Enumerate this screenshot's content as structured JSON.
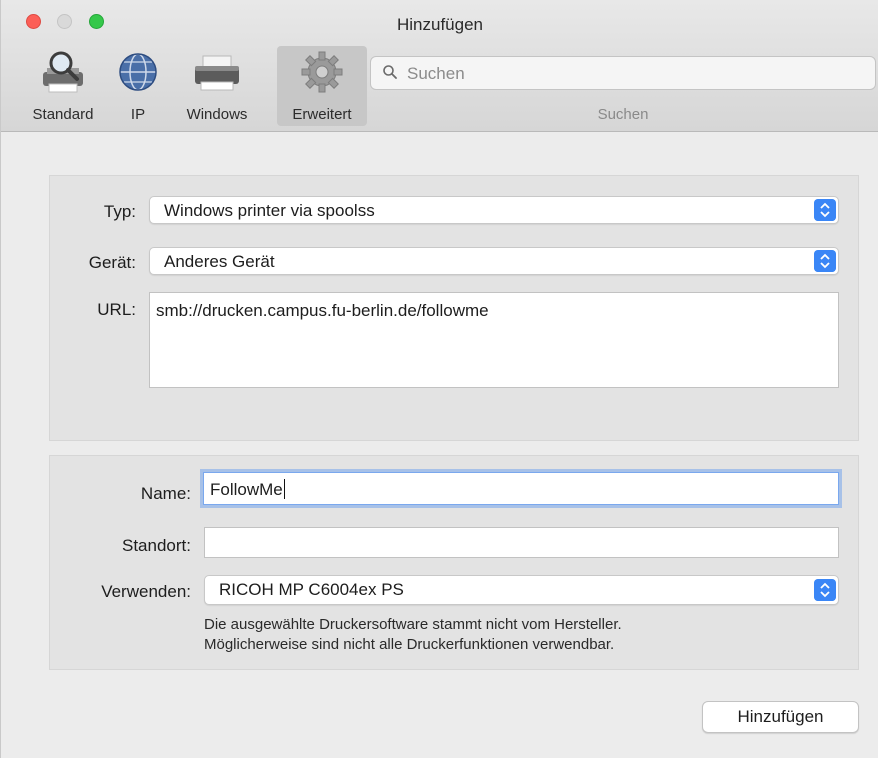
{
  "window": {
    "title": "Hinzufügen"
  },
  "toolbar": {
    "items": [
      {
        "label": "Standard",
        "icon": "magnifier-printer-icon"
      },
      {
        "label": "IP",
        "icon": "globe-icon"
      },
      {
        "label": "Windows",
        "icon": "printer-icon"
      },
      {
        "label": "Erweitert",
        "icon": "gear-icon",
        "selected": true
      }
    ],
    "search": {
      "placeholder": "Suchen",
      "caption": "Suchen"
    }
  },
  "connection": {
    "type_label": "Typ:",
    "type_value": "Windows printer via spoolss",
    "device_label": "Gerät:",
    "device_value": "Anderes Gerät",
    "url_label": "URL:",
    "url_value": "smb://drucken.campus.fu-berlin.de/followme"
  },
  "printer": {
    "name_label": "Name:",
    "name_value": "FollowMe",
    "location_label": "Standort:",
    "location_value": "",
    "use_label": "Verwenden:",
    "use_value": "RICOH MP C6004ex PS",
    "note_line1": "Die ausgewählte Druckersoftware stammt nicht vom Hersteller.",
    "note_line2": "Möglicherweise sind nicht alle Druckerfunktionen verwendbar."
  },
  "actions": {
    "add_label": "Hinzufügen"
  },
  "colors": {
    "accent": "#2f7ef5",
    "close": "#fc5f57",
    "maximize": "#35c84a"
  }
}
